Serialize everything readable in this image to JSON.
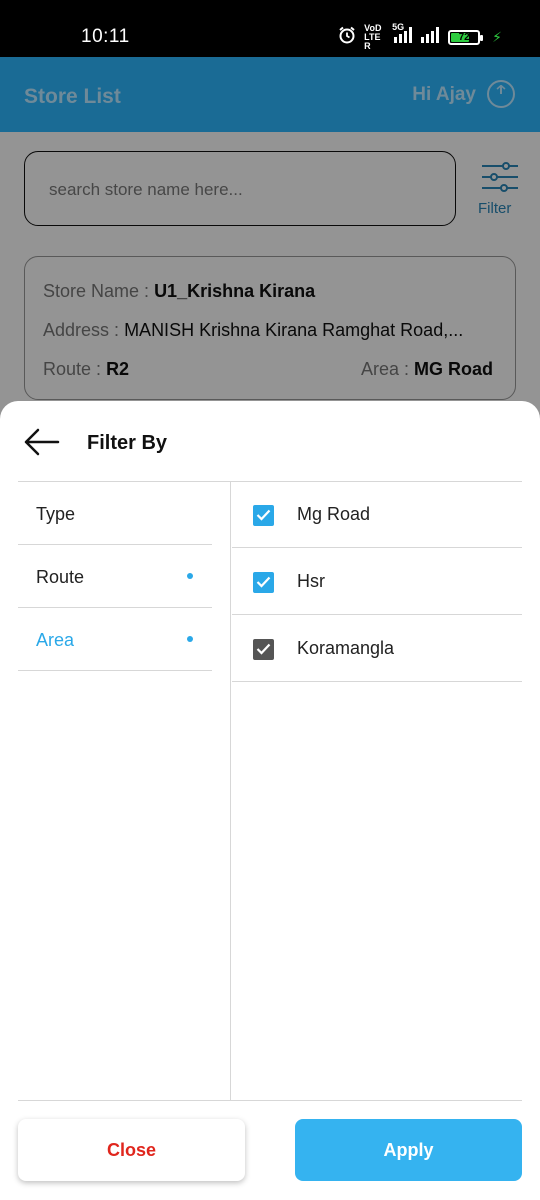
{
  "status_bar": {
    "time": "10:11",
    "network_label": "VoD LTE R",
    "network_5g": "5G",
    "battery_level": "72",
    "battery_fraction": 0.72,
    "icons": [
      "alarm-icon",
      "signal-icon",
      "battery-icon",
      "charging-icon"
    ]
  },
  "header": {
    "title": "Store List",
    "greeting": "Hi Ajay",
    "logout_icon": "power-icon",
    "background": "#1a6b95"
  },
  "search": {
    "placeholder": "search store name here..."
  },
  "filter_button": {
    "label": "Filter",
    "icon": "sliders-icon"
  },
  "store_card": {
    "name_label": "Store Name :",
    "name_value": "U1_Krishna Kirana",
    "address_label": "Address :",
    "address_value": "MANISH Krishna Kirana Ramghat Road,...",
    "route_label": "Route :",
    "route_value": "R2",
    "area_label": "Area :",
    "area_value": "MG Road"
  },
  "filter_sheet": {
    "title": "Filter By",
    "back_icon": "arrow-left-icon",
    "categories": [
      {
        "label": "Type",
        "selected": false,
        "has_active_filter": false
      },
      {
        "label": "Route",
        "selected": false,
        "has_active_filter": true
      },
      {
        "label": "Area",
        "selected": true,
        "has_active_filter": true
      }
    ],
    "options": [
      {
        "label": "Mg Road",
        "checked": true,
        "color": "#2aa8e8"
      },
      {
        "label": "Hsr",
        "checked": true,
        "color": "#2aa8e8"
      },
      {
        "label": "Koramangla",
        "checked": true,
        "color": "#555555"
      }
    ],
    "close_label": "Close",
    "apply_label": "Apply",
    "accent_color": "#35b3f0",
    "close_color": "#e0261d"
  }
}
